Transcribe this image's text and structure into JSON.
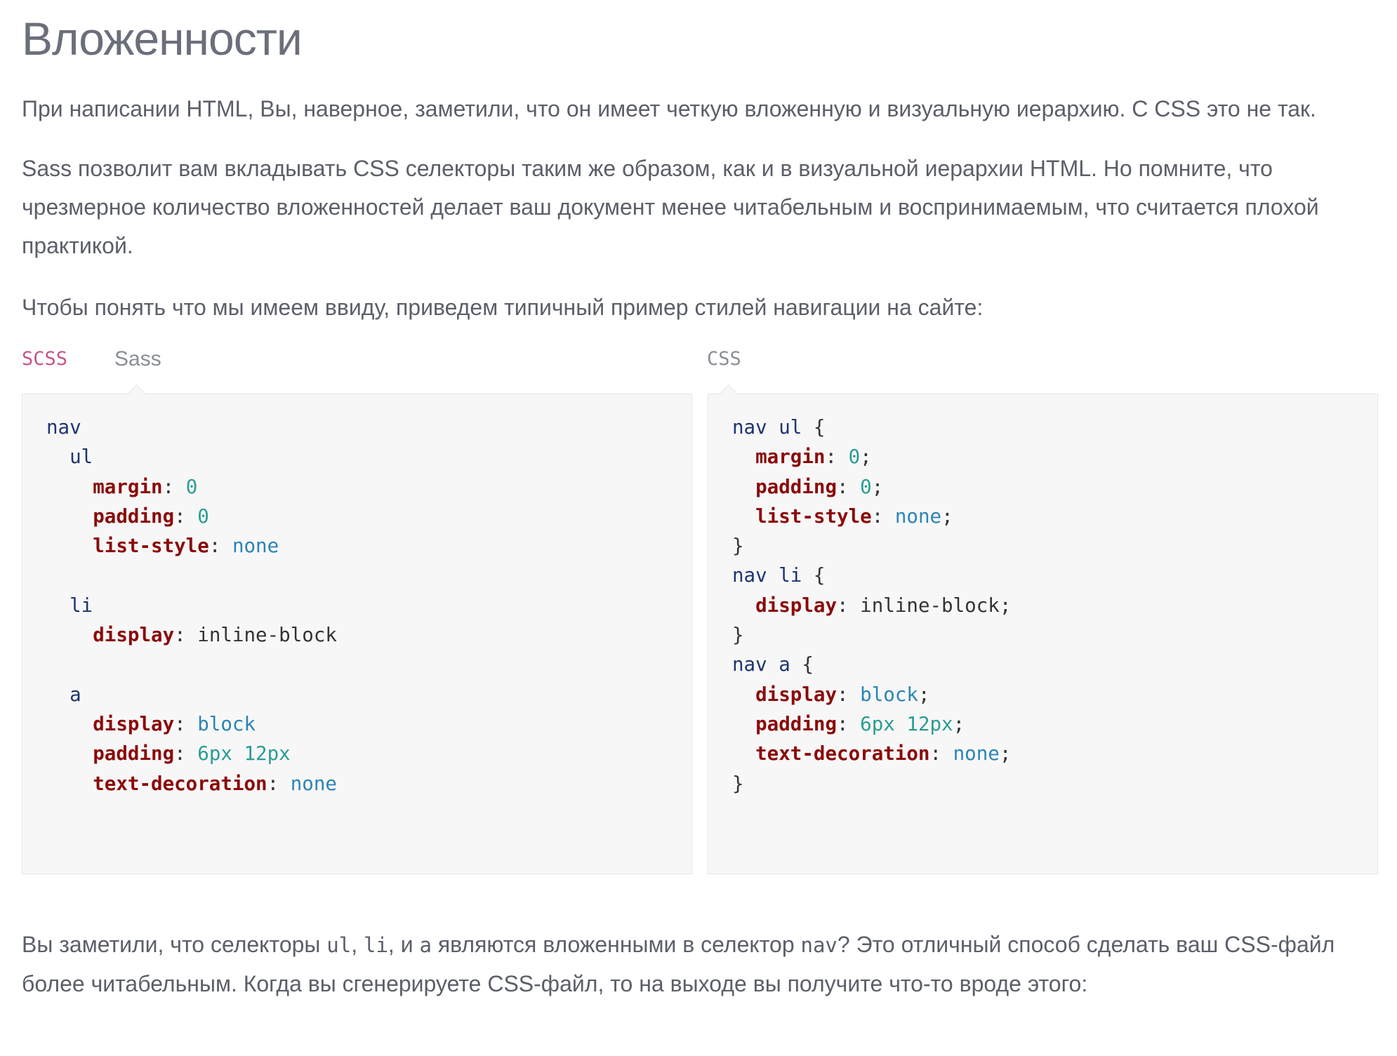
{
  "heading": "Вложенности",
  "paragraphs": {
    "p1": "При написании HTML, Вы, наверное, заметили, что он имеет четкую вложенную и визуальную иерархию. С CSS это не так.",
    "p2": "Sass позволит вам вкладывать CSS селекторы таким же образом, как и в визуальной иерархии HTML. Но помните, что чрезмерное количество вложенностей делает ваш документ менее читабельным и воспринимаемым, что считается плохой практикой.",
    "p3": "Чтобы понять что мы имеем ввиду, приведем типичный пример стилей навигации на сайте:",
    "p4": {
      "t1": "Вы заметили, что селекторы ",
      "c1": "ul",
      "t2": ", ",
      "c2": "li",
      "t3": ", и ",
      "c3": "a",
      "t4": " являются вложенными в селектор ",
      "c4": "nav",
      "t5": "? Это отличный способ сделать ваш CSS-файл более читабельным. Когда вы сгенерируете CSS-файл, то на выходе вы получите что-то вроде этого:"
    }
  },
  "tabs": {
    "scss": "SCSS",
    "sass": "Sass",
    "css": "CSS"
  },
  "code": {
    "sass": {
      "l1": "nav",
      "l2": "ul",
      "margin": "margin",
      "margin_val": "0",
      "padding": "padding",
      "padding_val": "0",
      "list_style": "list-style",
      "list_style_val": "none",
      "li": "li",
      "display": "display",
      "display_val": "inline-block",
      "a": "a",
      "display2": "display",
      "display2_val": "block",
      "padding2": "padding",
      "padding2_val1": "6px",
      "padding2_val2": "12px",
      "text_decoration": "text-decoration",
      "text_decoration_val": "none"
    },
    "css": {
      "s1": "nav ul",
      "margin": "margin",
      "margin_val": "0",
      "padding": "padding",
      "padding_val": "0",
      "list_style": "list-style",
      "list_style_val": "none",
      "s2": "nav li",
      "display": "display",
      "display_val": "inline-block",
      "s3": "nav a",
      "display2": "display",
      "display2_val": "block",
      "padding2": "padding",
      "padding2_val1": "6px",
      "padding2_val2": "12px",
      "text_decoration": "text-decoration",
      "text_decoration_val": "none"
    }
  },
  "colors": {
    "tab_active": "#c6538c",
    "selector": "#1e3570",
    "property": "#8b0a0a",
    "number": "#2a9d93",
    "keyword": "#2a84b8",
    "code_bg": "#f7f7f7"
  }
}
